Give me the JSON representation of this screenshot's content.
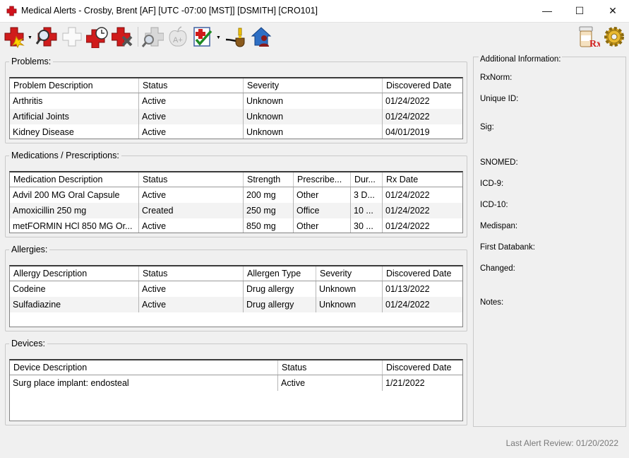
{
  "window": {
    "title": "Medical Alerts - Crosby, Brent [AF] [UTC -07:00 [MST]] [DSMITH] [CRO101]",
    "minimize": "—",
    "maximize": "☐",
    "close": "✕"
  },
  "problems": {
    "legend": "Problems:",
    "columns": [
      "Problem Description",
      "Status",
      "Severity",
      "Discovered Date"
    ],
    "rows": [
      [
        "Arthritis",
        "Active",
        "Unknown",
        "01/24/2022"
      ],
      [
        "Artificial Joints",
        "Active",
        "Unknown",
        "01/24/2022"
      ],
      [
        "Kidney Disease",
        "Active",
        "Unknown",
        "04/01/2019"
      ]
    ]
  },
  "medications": {
    "legend": "Medications / Prescriptions:",
    "columns": [
      "Medication Description",
      "Status",
      "Strength",
      "Prescribe...",
      "Dur...",
      "Rx Date"
    ],
    "rows": [
      [
        "Advil 200 MG Oral Capsule",
        "Active",
        "200 mg",
        "Other",
        "3 D...",
        "01/24/2022"
      ],
      [
        "Amoxicillin 250 mg",
        "Created",
        "250 mg",
        "Office",
        "10 ...",
        "01/24/2022"
      ],
      [
        "metFORMIN HCl 850 MG Or...",
        "Active",
        "850 mg",
        "Other",
        "30 ...",
        "01/24/2022"
      ]
    ]
  },
  "allergies": {
    "legend": "Allergies:",
    "columns": [
      "Allergy Description",
      "Status",
      "Allergen Type",
      "Severity",
      "Discovered Date"
    ],
    "rows": [
      [
        "Codeine",
        "Active",
        "Drug allergy",
        "Unknown",
        "01/13/2022"
      ],
      [
        "Sulfadiazine",
        "Active",
        "Drug allergy",
        "Unknown",
        "01/24/2022"
      ]
    ]
  },
  "devices": {
    "legend": "Devices:",
    "columns": [
      "Device Description",
      "Status",
      "Discovered Date"
    ],
    "rows": [
      [
        "Surg place implant: endosteal",
        "Active",
        "1/21/2022"
      ]
    ]
  },
  "info": {
    "legend": "Additional Information:",
    "labels": [
      "RxNorm:",
      "Unique ID:",
      "Sig:",
      "SNOMED:",
      "ICD-9:",
      "ICD-10:",
      "Medispan:",
      "First Databank:",
      "Changed:",
      "Notes:"
    ]
  },
  "footer": {
    "last_review": "Last Alert Review: 01/20/2022"
  }
}
